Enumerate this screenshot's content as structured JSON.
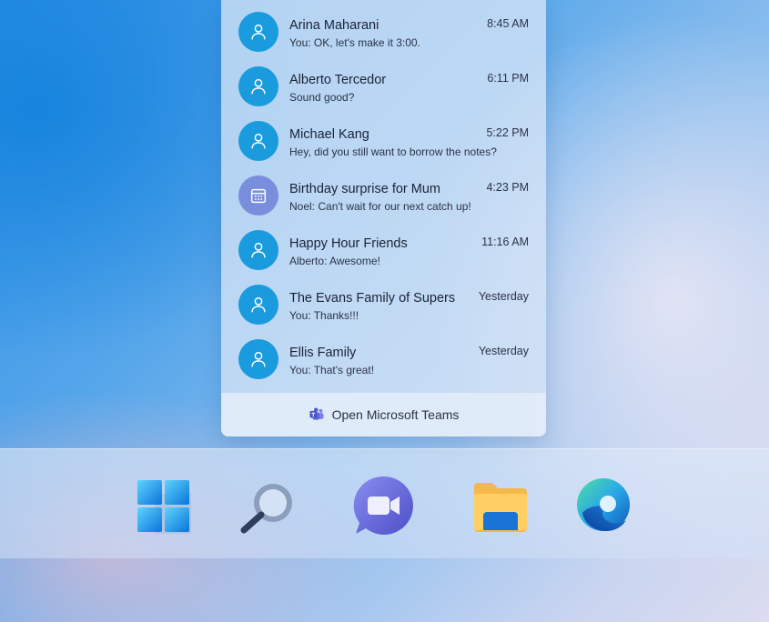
{
  "chats": [
    {
      "name": "Arina Maharani",
      "preview": "You: OK, let's make it 3:00.",
      "time": "8:45 AM",
      "avatar_icon": "person-icon"
    },
    {
      "name": "Alberto Tercedor",
      "preview": "Sound good?",
      "time": "6:11 PM",
      "avatar_icon": "person-icon"
    },
    {
      "name": "Michael Kang",
      "preview": "Hey, did you still want to borrow the notes?",
      "time": "5:22 PM",
      "avatar_icon": "person-icon"
    },
    {
      "name": "Birthday surprise for Mum",
      "preview": "Noel: Can't wait for our next catch up!",
      "time": "4:23 PM",
      "avatar_icon": "calendar-icon"
    },
    {
      "name": "Happy Hour Friends",
      "preview": "Alberto: Awesome!",
      "time": "11:16 AM",
      "avatar_icon": "person-icon"
    },
    {
      "name": "The Evans Family of Supers",
      "preview": "You: Thanks!!!",
      "time": "Yesterday",
      "avatar_icon": "person-icon"
    },
    {
      "name": "Ellis Family",
      "preview": "You: That's great!",
      "time": "Yesterday",
      "avatar_icon": "person-icon"
    }
  ],
  "footer": {
    "label": "Open Microsoft Teams",
    "icon": "teams-icon"
  },
  "taskbar": {
    "icons": [
      "windows-start-icon",
      "search-icon",
      "teams-chat-icon",
      "file-explorer-icon",
      "edge-browser-icon"
    ]
  },
  "colors": {
    "avatar_person": "#1a9bde",
    "avatar_group": "#7a8ede",
    "panel_bg": "#d6e4f6"
  }
}
